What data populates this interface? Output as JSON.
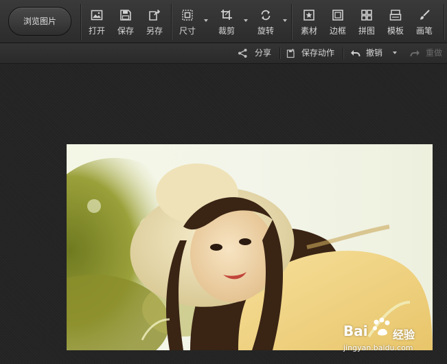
{
  "toolbar": {
    "browse_label": "浏览图片",
    "tools": [
      {
        "name": "open",
        "label": "打开",
        "icon": "image-open-icon"
      },
      {
        "name": "save",
        "label": "保存",
        "icon": "floppy-save-icon"
      },
      {
        "name": "save-as",
        "label": "另存",
        "icon": "save-as-icon"
      },
      {
        "name": "size",
        "label": "尺寸",
        "icon": "resize-icon"
      },
      {
        "name": "crop",
        "label": "裁剪",
        "icon": "crop-icon"
      },
      {
        "name": "rotate",
        "label": "旋转",
        "icon": "rotate-icon"
      },
      {
        "name": "material",
        "label": "素材",
        "icon": "sticker-star-icon"
      },
      {
        "name": "border",
        "label": "边框",
        "icon": "frame-icon"
      },
      {
        "name": "collage",
        "label": "拼图",
        "icon": "collage-grid-icon"
      },
      {
        "name": "template",
        "label": "模板",
        "icon": "template-icon"
      },
      {
        "name": "brush",
        "label": "画笔",
        "icon": "brush-icon"
      }
    ]
  },
  "subbar": {
    "share": "分享",
    "save_action": "保存动作",
    "undo": "撤销",
    "redo": "重做"
  },
  "watermark": {
    "brand": "Bai",
    "brand_suffix": "经验",
    "url": "jingyan.baidu.com"
  },
  "colors": {
    "toolbar_bg": "#333333",
    "canvas_bg": "#232323",
    "text": "#d8d8d8",
    "disabled_text": "#6a6a6a"
  }
}
